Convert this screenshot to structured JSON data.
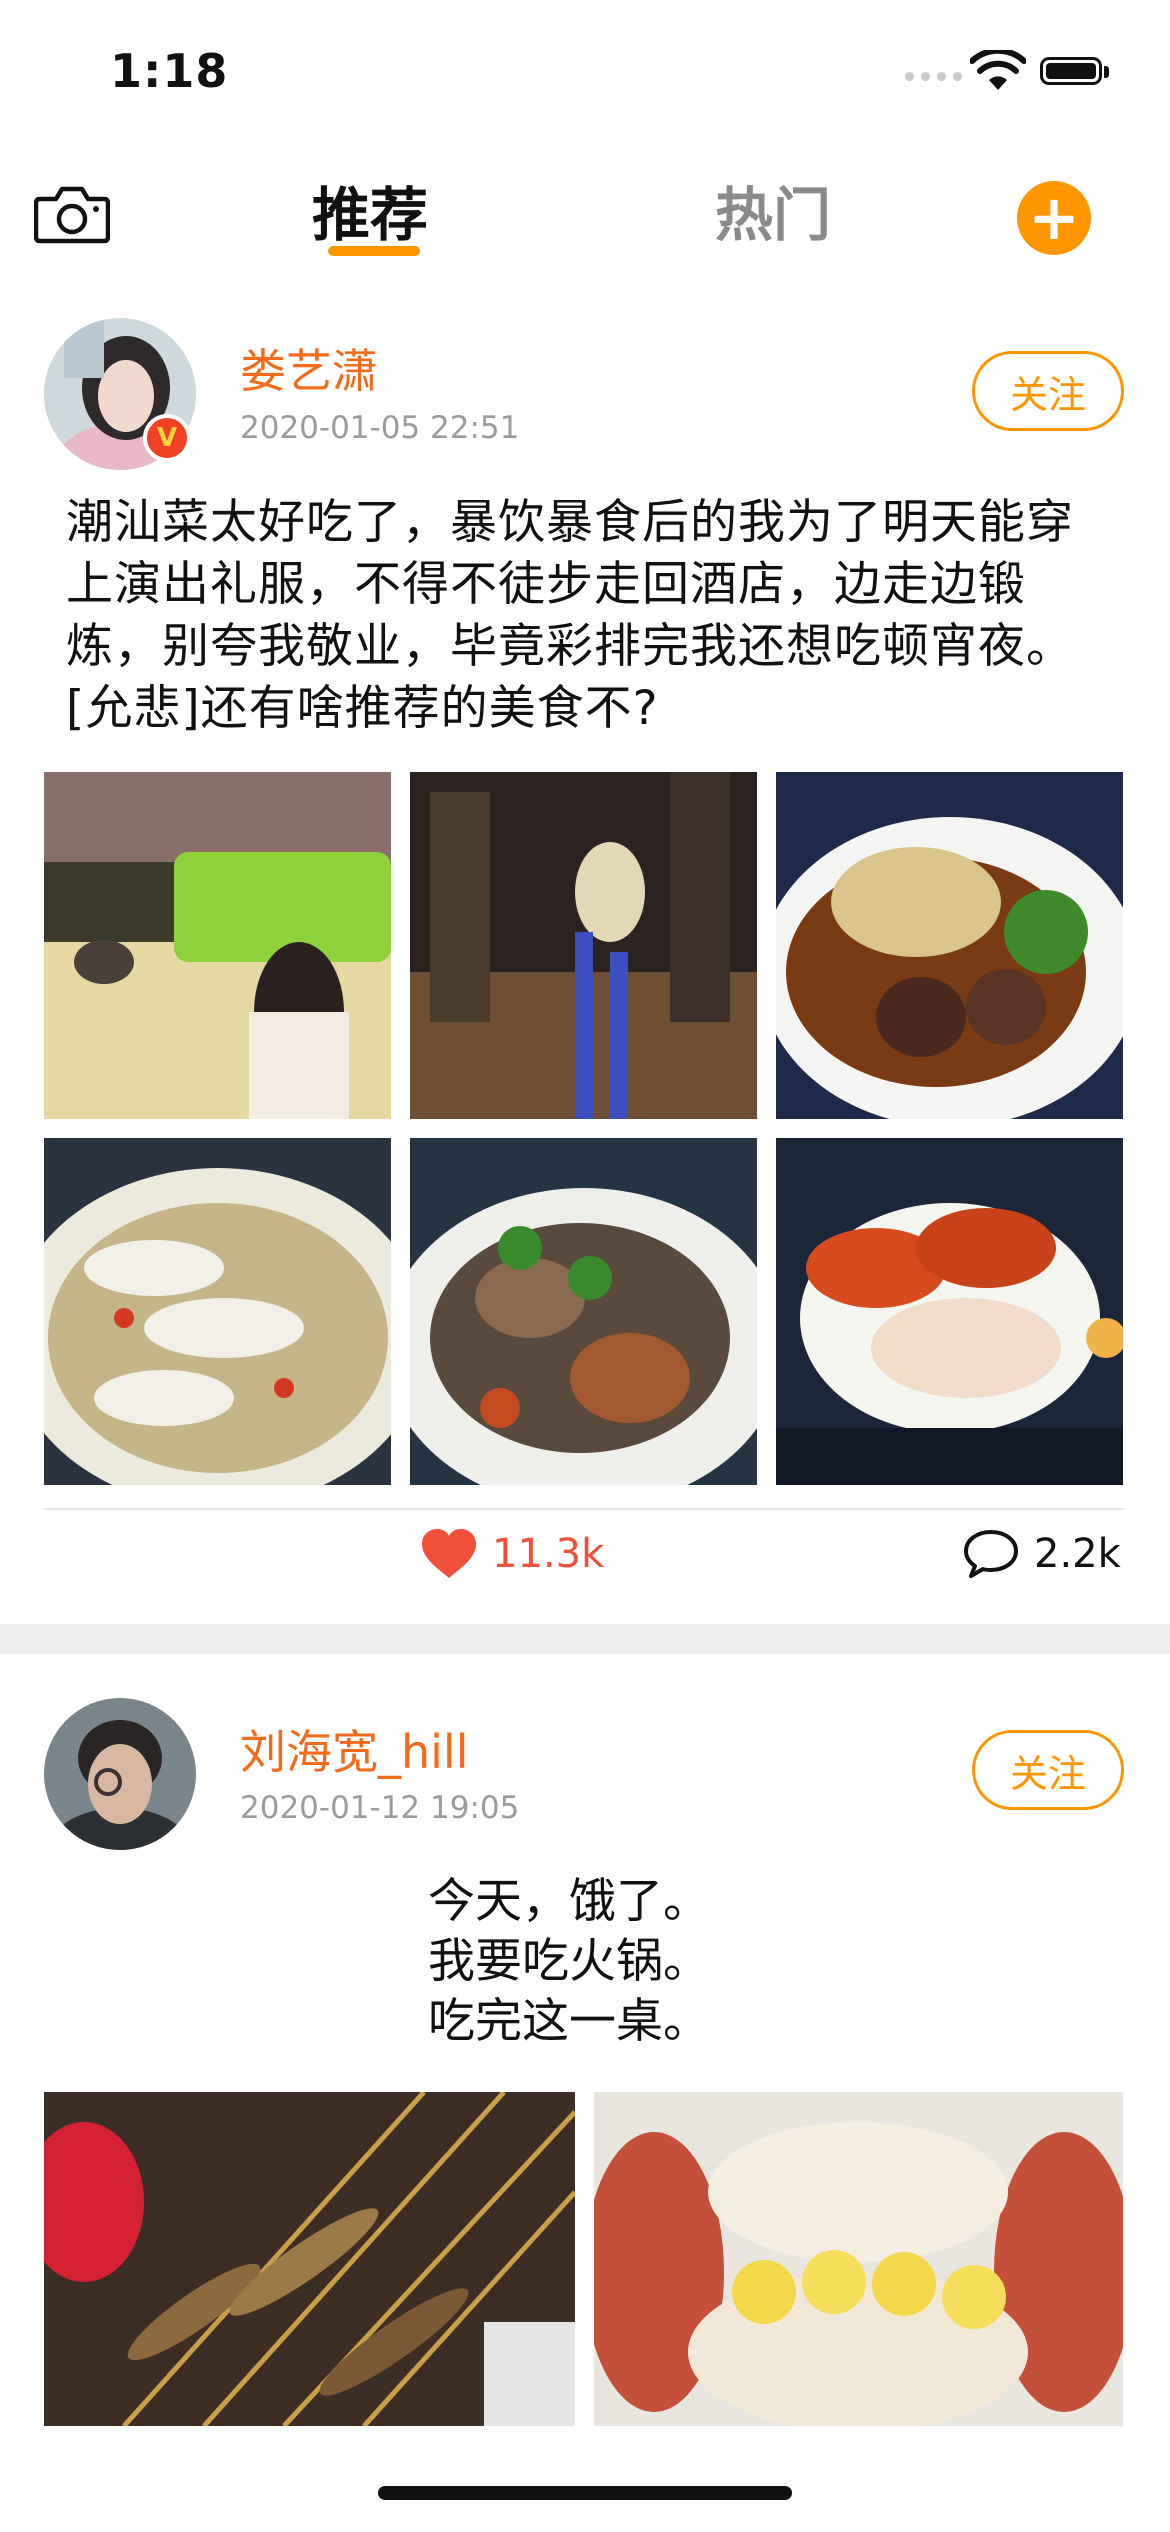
{
  "status_bar": {
    "time": "1:18"
  },
  "nav": {
    "tabs": [
      {
        "label": "推荐",
        "active": true
      },
      {
        "label": "热门",
        "active": false
      }
    ],
    "add_icon": "plus-icon",
    "camera_icon": "camera-icon",
    "accent_color": "#ff9500"
  },
  "posts": [
    {
      "username": "娄艺潇",
      "timestamp": "2020-01-05 22:51",
      "follow_label": "关注",
      "verified_label": "V",
      "text": "潮汕菜太好吃了，暴饮暴食后的我为了明天能穿上演出礼服，不得不徒步走回酒店，边走边锻炼，别夸我敬业，毕竟彩排完我还想吃顿宵夜。[允悲]还有啥推荐的美食不?",
      "photo_count": 6,
      "likes": "11.3k",
      "comments": "2.2k"
    },
    {
      "username": "刘海宽_hill",
      "timestamp": "2020-01-12 19:05",
      "follow_label": "关注",
      "text": "今天，饿了。\n我要吃火锅。\n吃完这一桌。",
      "photo_count": 2
    }
  ],
  "colors": {
    "username": "#f26b1d",
    "like": "#f0503a",
    "timestamp": "#9b9b9b"
  }
}
